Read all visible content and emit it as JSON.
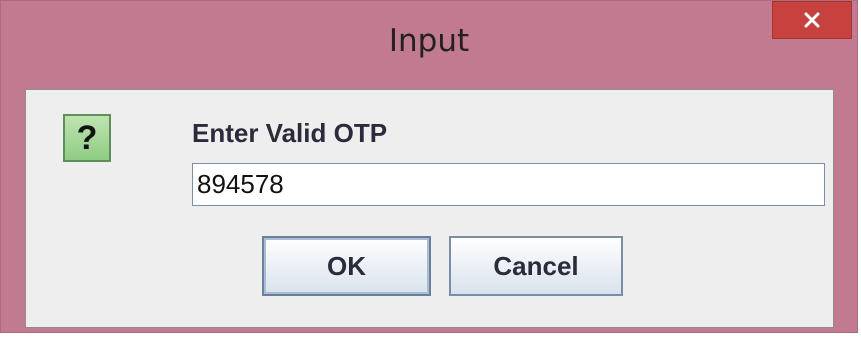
{
  "window": {
    "title": "Input",
    "close_icon": "close-icon",
    "title_color": "#c27a90",
    "close_color": "#c7413e"
  },
  "dialog": {
    "icon": "question-icon",
    "icon_glyph": "?",
    "prompt": "Enter Valid OTP",
    "input_value": "894578",
    "ok_label": "OK",
    "cancel_label": "Cancel"
  }
}
